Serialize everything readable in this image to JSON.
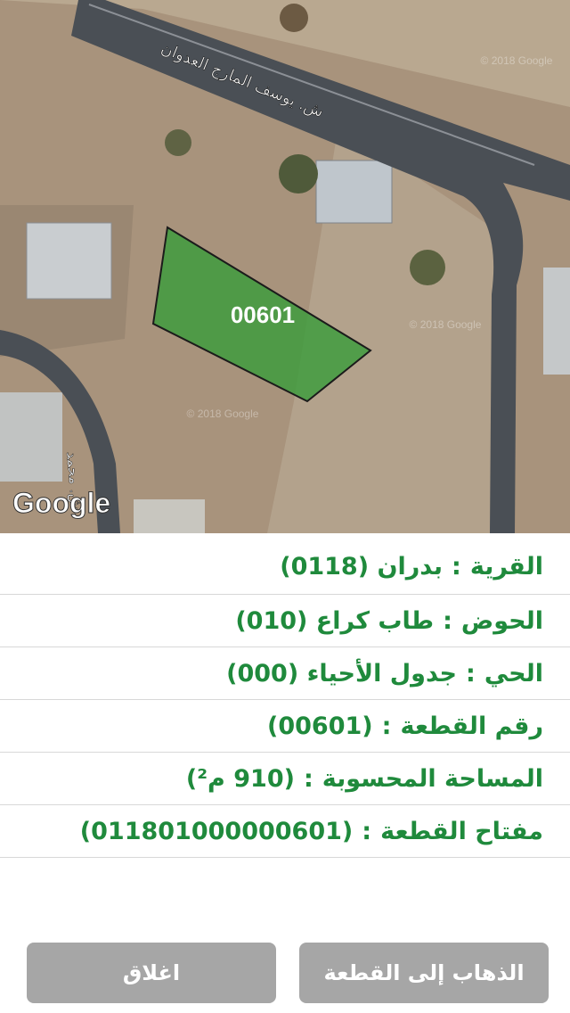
{
  "map": {
    "street_label": "ش. يوسف المارج العدوان",
    "street_label_2": "ش. محمد",
    "parcel_label": "00601",
    "watermark": "© 2018 Google",
    "provider": "Google",
    "colors": {
      "parcel_fill": "#3c9c3c",
      "parcel_stroke": "#1b1b1b",
      "road": "#4a4f55"
    }
  },
  "info": {
    "village": {
      "label": "القرية",
      "value": "بدران (0118)"
    },
    "basin": {
      "label": "الحوض",
      "value": "طاب كراع (010)"
    },
    "district": {
      "label": "الحي",
      "value": "جدول الأحياء (000)"
    },
    "parcel_number": {
      "label": "رقم القطعة",
      "value": "(00601)"
    },
    "area": {
      "label": "المساحة المحسوبة",
      "value": "(910 م²)"
    },
    "parcel_key": {
      "label": "مفتاح القطعة",
      "value": "(011801000000601)"
    }
  },
  "separator": ":",
  "buttons": {
    "close": "اغلاق",
    "go_to_parcel": "الذهاب إلى القطعة"
  }
}
